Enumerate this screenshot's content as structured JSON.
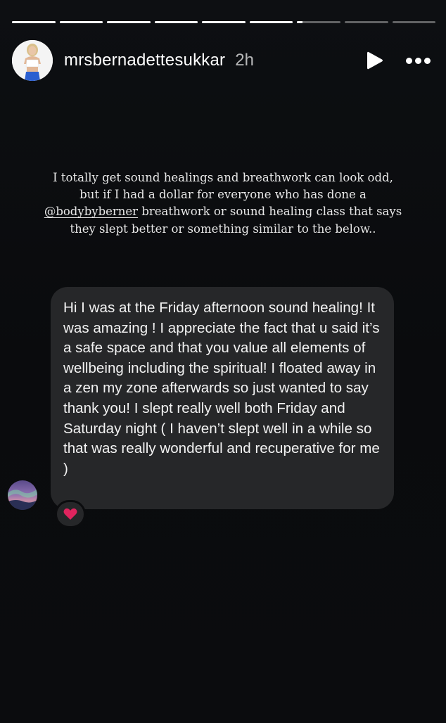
{
  "story": {
    "segments": [
      {
        "progress": 1
      },
      {
        "progress": 1
      },
      {
        "progress": 1
      },
      {
        "progress": 1
      },
      {
        "progress": 1
      },
      {
        "progress": 1
      },
      {
        "progress": 0.12
      },
      {
        "progress": 0
      },
      {
        "progress": 0
      }
    ]
  },
  "header": {
    "username": "mrsbernadettesukkar",
    "time": "2h",
    "play_icon": "play-icon",
    "more_icon": "more-horizontal-icon"
  },
  "caption": {
    "before_mention": "I totally get sound healings and breathwork can look odd, but if I had a dollar for everyone who has done a ",
    "mention": "@bodybyberner",
    "after_mention": " breathwork or sound healing class that says they slept better or something similar to the below.."
  },
  "message": {
    "text": "Hi I was at the Friday afternoon sound healing! It was amazing ! I appreciate the fact that u said it’s a safe space and that you value all elements of wellbeing including the spiritual! I floated away in a zen  my zone afterwards so just wanted to say thank you! I slept really well both Friday and Saturday night ( I haven’t slept well in a while so that was really wonderful and recuperative for me )",
    "reaction_icon": "heart-icon",
    "reaction_color": "#e0245e"
  },
  "colors": {
    "background": "#0b0c0e",
    "bubble": "#262729",
    "text": "#ffffff"
  }
}
